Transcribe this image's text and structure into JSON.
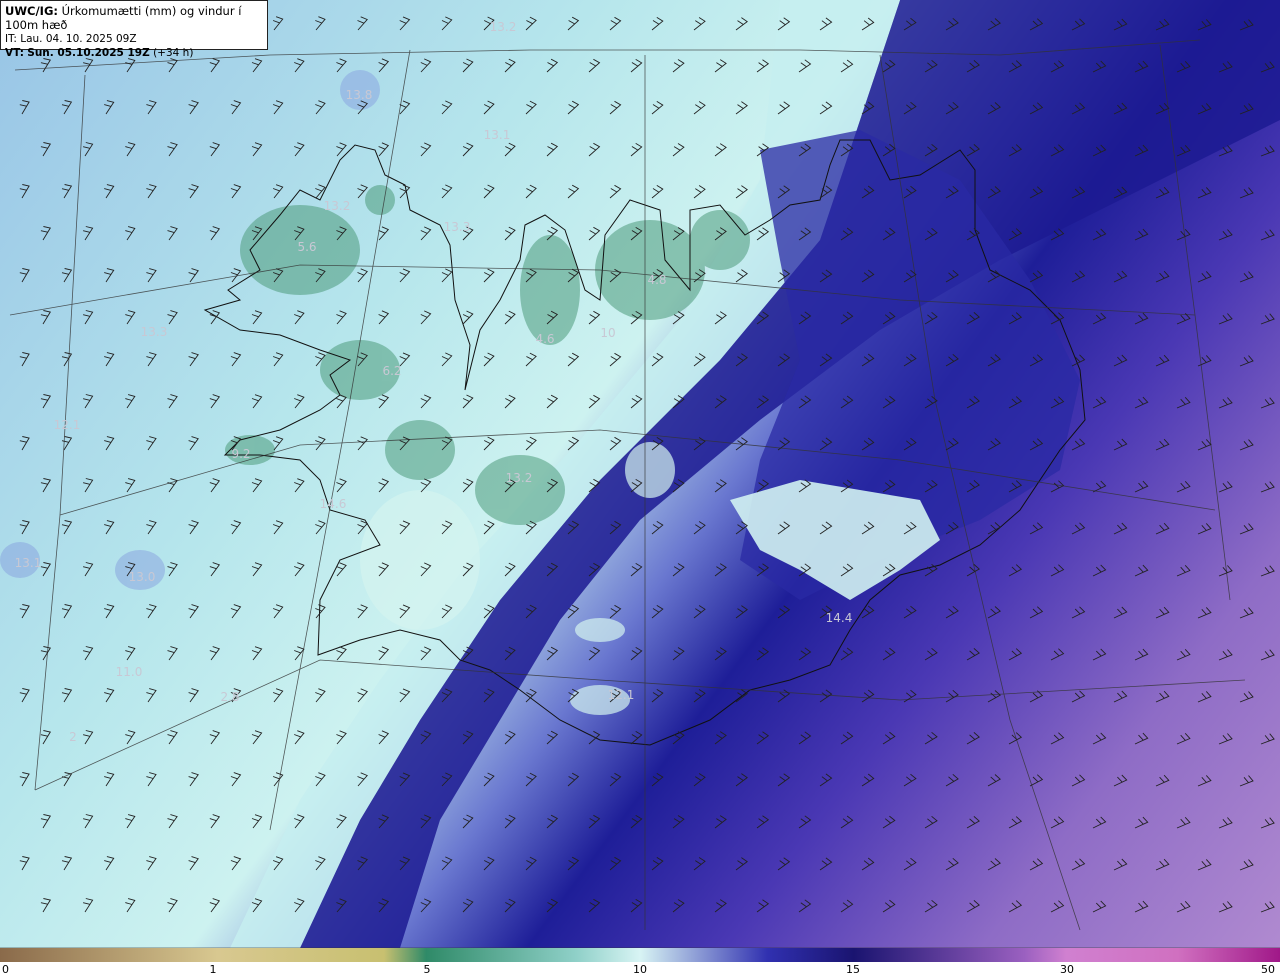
{
  "header": {
    "model": "UWC/IG:",
    "title": "Úrkomumætti (mm) og vindur í 100m hæð",
    "it_line": "IT: Lau. 04. 10. 2025 09Z",
    "vt_label": "VT:",
    "vt_value": "Sun. 05.10.2025 19Z",
    "vt_offset": "(+34 h)"
  },
  "value_labels": [
    "13.2",
    "13.8",
    "13.1",
    "13.2",
    "13.3",
    "5.6",
    "4.8",
    "13.3",
    "4.6",
    "6.2",
    "12.1",
    "9.2",
    "13.2",
    "14.6",
    "13.1",
    "13.0",
    "14.4",
    "12.1",
    "10",
    "11.0",
    "2.8",
    "2"
  ],
  "colorbar": {
    "ticks": [
      "0",
      "1",
      "5",
      "10",
      "15",
      "30",
      "50"
    ],
    "stops": [
      "#8a6a4a",
      "#d8c890",
      "#e8d078",
      "#2f8a68",
      "#8fd0c8",
      "#d8f4f4",
      "#3030b0",
      "#1a1470",
      "#9a60c0",
      "#d080d0",
      "#a01888"
    ]
  },
  "colors": {
    "dry_green": "#4a9a78",
    "light_cyan": "#c8f0f0",
    "pale_blue": "#a8c8ec",
    "deep_blue": "#1c1c96",
    "violet": "#8a68c4",
    "purple": "#b088d0"
  }
}
